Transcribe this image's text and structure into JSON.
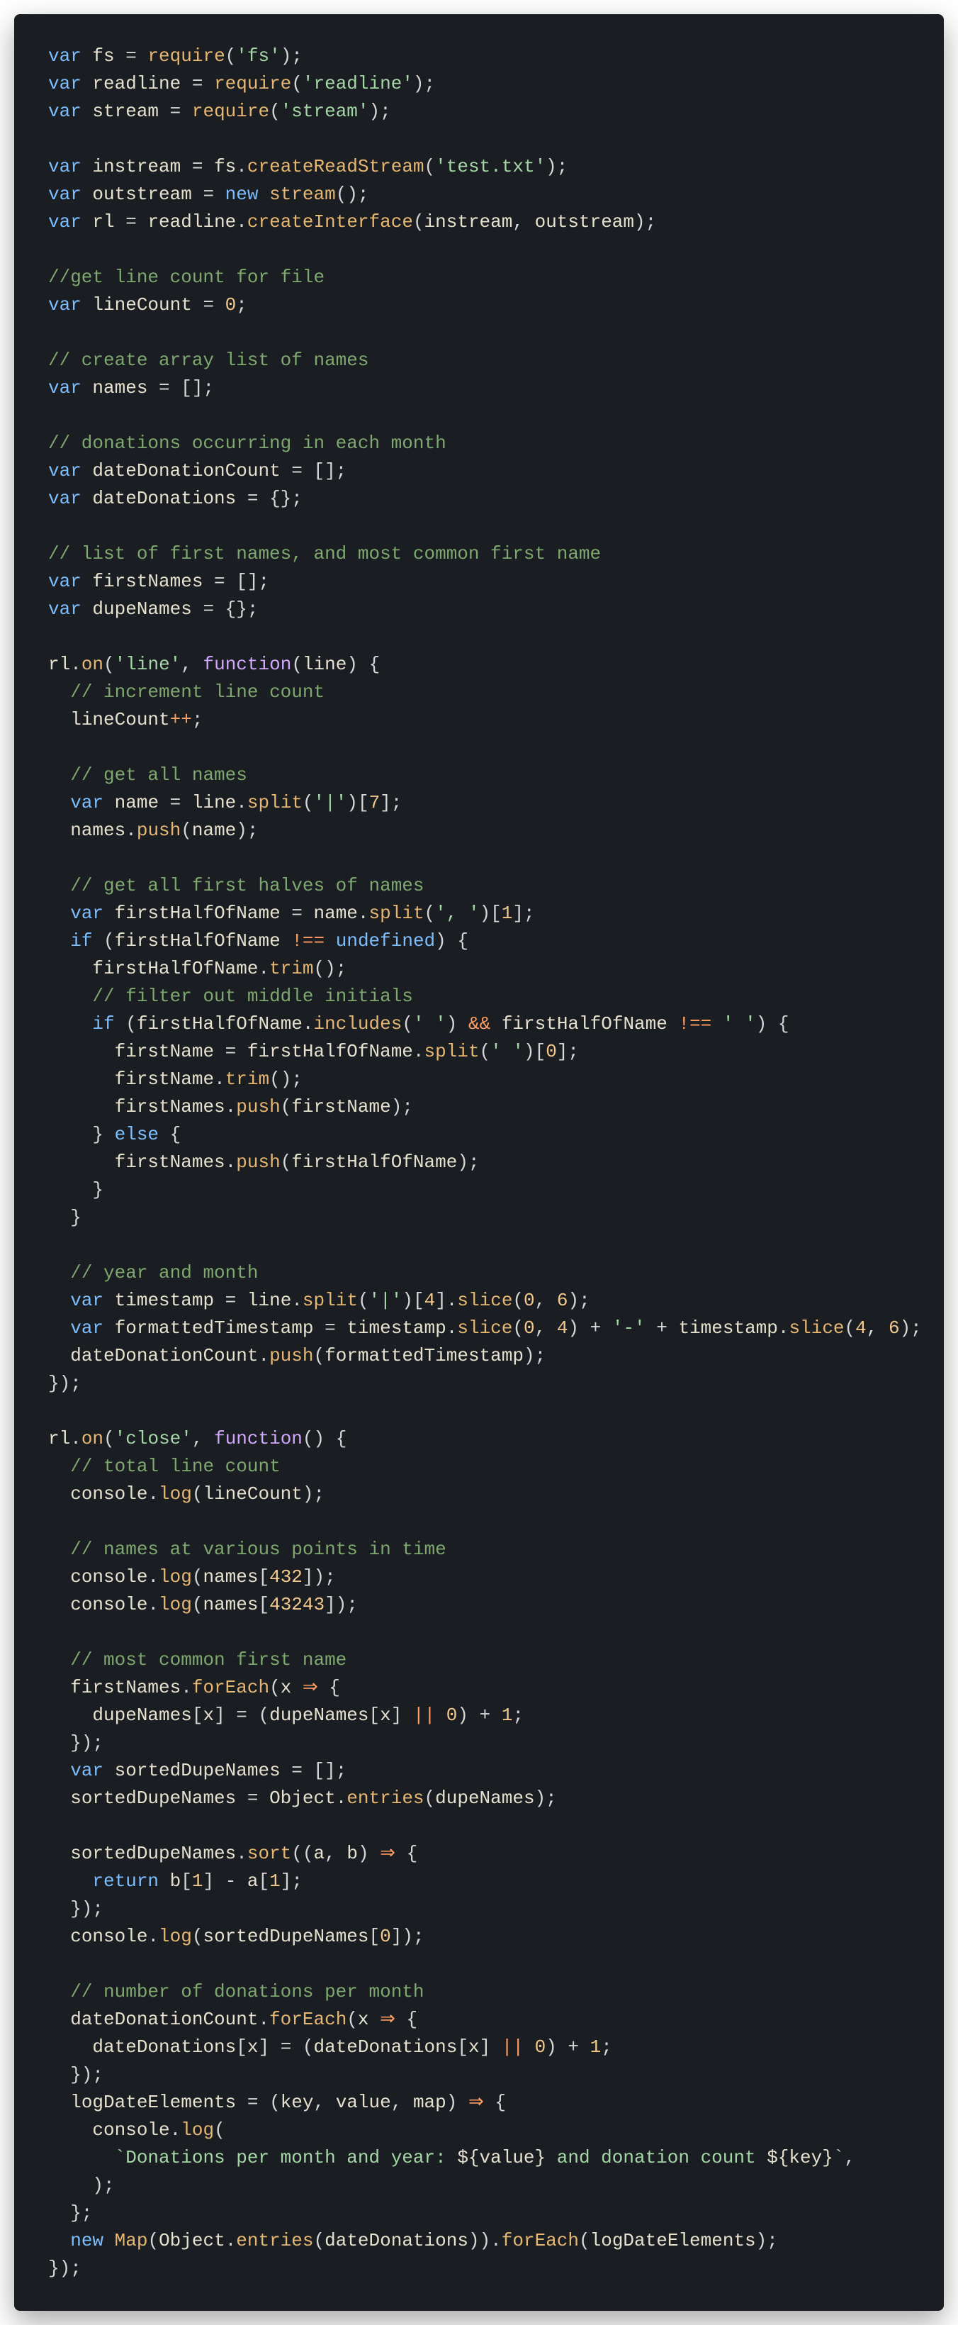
{
  "code": {
    "lines": [
      [
        [
          "kw",
          "var "
        ],
        [
          "id",
          "fs "
        ],
        [
          "",
          "= "
        ],
        [
          "call",
          "require"
        ],
        [
          "",
          "("
        ],
        [
          "str",
          "'fs'"
        ],
        [
          "",
          ");"
        ]
      ],
      [
        [
          "kw",
          "var "
        ],
        [
          "id",
          "readline "
        ],
        [
          "",
          "= "
        ],
        [
          "call",
          "require"
        ],
        [
          "",
          "("
        ],
        [
          "str",
          "'readline'"
        ],
        [
          "",
          ");"
        ]
      ],
      [
        [
          "kw",
          "var "
        ],
        [
          "id",
          "stream "
        ],
        [
          "",
          "= "
        ],
        [
          "call",
          "require"
        ],
        [
          "",
          "("
        ],
        [
          "str",
          "'stream'"
        ],
        [
          "",
          ");"
        ]
      ],
      [
        [
          "",
          ""
        ]
      ],
      [
        [
          "kw",
          "var "
        ],
        [
          "id",
          "instream "
        ],
        [
          "",
          "= fs."
        ],
        [
          "call",
          "createReadStream"
        ],
        [
          "",
          "("
        ],
        [
          "str",
          "'test.txt'"
        ],
        [
          "",
          ");"
        ]
      ],
      [
        [
          "kw",
          "var "
        ],
        [
          "id",
          "outstream "
        ],
        [
          "",
          "= "
        ],
        [
          "kw",
          "new "
        ],
        [
          "call",
          "stream"
        ],
        [
          "",
          "();"
        ]
      ],
      [
        [
          "kw",
          "var "
        ],
        [
          "id",
          "rl "
        ],
        [
          "",
          "= readline."
        ],
        [
          "call",
          "createInterface"
        ],
        [
          "",
          "(instream, outstream);"
        ]
      ],
      [
        [
          "",
          ""
        ]
      ],
      [
        [
          "cmt2",
          "//get line count for file"
        ]
      ],
      [
        [
          "kw",
          "var "
        ],
        [
          "id",
          "lineCount "
        ],
        [
          "",
          "= "
        ],
        [
          "num",
          "0"
        ],
        [
          "",
          ";"
        ]
      ],
      [
        [
          "",
          ""
        ]
      ],
      [
        [
          "cmt2",
          "// create array list of names"
        ]
      ],
      [
        [
          "kw",
          "var "
        ],
        [
          "id",
          "names "
        ],
        [
          "",
          "= [];"
        ]
      ],
      [
        [
          "",
          ""
        ]
      ],
      [
        [
          "cmt2",
          "// donations occurring in each month"
        ]
      ],
      [
        [
          "kw",
          "var "
        ],
        [
          "id",
          "dateDonationCount "
        ],
        [
          "",
          "= [];"
        ]
      ],
      [
        [
          "kw",
          "var "
        ],
        [
          "id",
          "dateDonations "
        ],
        [
          "",
          "= {};"
        ]
      ],
      [
        [
          "",
          ""
        ]
      ],
      [
        [
          "cmt2",
          "// list of first names, and most common first name"
        ]
      ],
      [
        [
          "kw",
          "var "
        ],
        [
          "id",
          "firstNames "
        ],
        [
          "",
          "= [];"
        ]
      ],
      [
        [
          "kw",
          "var "
        ],
        [
          "id",
          "dupeNames "
        ],
        [
          "",
          "= {};"
        ]
      ],
      [
        [
          "",
          ""
        ]
      ],
      [
        [
          "",
          "rl."
        ],
        [
          "call",
          "on"
        ],
        [
          "",
          "("
        ],
        [
          "str",
          "'line'"
        ],
        [
          "",
          ", "
        ],
        [
          "fn",
          "function"
        ],
        [
          "",
          "(line) {"
        ]
      ],
      [
        [
          "",
          "  "
        ],
        [
          "cmt2",
          "// increment line count"
        ]
      ],
      [
        [
          "",
          "  lineCount"
        ],
        [
          "op",
          "++"
        ],
        [
          "",
          ";"
        ]
      ],
      [
        [
          "",
          ""
        ]
      ],
      [
        [
          "",
          "  "
        ],
        [
          "cmt2",
          "// get all names"
        ]
      ],
      [
        [
          "",
          "  "
        ],
        [
          "kw",
          "var "
        ],
        [
          "id",
          "name "
        ],
        [
          "",
          "= line."
        ],
        [
          "call",
          "split"
        ],
        [
          "",
          "("
        ],
        [
          "str",
          "'|'"
        ],
        [
          "",
          ")["
        ],
        [
          "num",
          "7"
        ],
        [
          "",
          "];"
        ]
      ],
      [
        [
          "",
          "  names."
        ],
        [
          "call",
          "push"
        ],
        [
          "",
          "(name);"
        ]
      ],
      [
        [
          "",
          ""
        ]
      ],
      [
        [
          "",
          "  "
        ],
        [
          "cmt2",
          "// get all first halves of names"
        ]
      ],
      [
        [
          "",
          "  "
        ],
        [
          "kw",
          "var "
        ],
        [
          "id",
          "firstHalfOfName "
        ],
        [
          "",
          "= name."
        ],
        [
          "call",
          "split"
        ],
        [
          "",
          "("
        ],
        [
          "str",
          "', '"
        ],
        [
          "",
          ")["
        ],
        [
          "num",
          "1"
        ],
        [
          "",
          "];"
        ]
      ],
      [
        [
          "",
          "  "
        ],
        [
          "kw",
          "if "
        ],
        [
          "",
          "(firstHalfOfName "
        ],
        [
          "op",
          "!=="
        ],
        [
          "",
          ""
        ],
        [
          "",
          "= "
        ],
        [
          "kw",
          "undefined"
        ],
        [
          "",
          ") {"
        ]
      ],
      [
        [
          "",
          "    firstHalfOfName."
        ],
        [
          "call",
          "trim"
        ],
        [
          "",
          "();"
        ]
      ],
      [
        [
          "",
          "    "
        ],
        [
          "cmt2",
          "// filter out middle initials"
        ]
      ],
      [
        [
          "",
          "    "
        ],
        [
          "kw",
          "if "
        ],
        [
          "",
          "(firstHalfOfName."
        ],
        [
          "call",
          "includes"
        ],
        [
          "",
          "("
        ],
        [
          "str",
          "' '"
        ],
        [
          "",
          ") "
        ],
        [
          "op",
          "&&"
        ],
        [
          "",
          ""
        ],
        [
          "",
          ""
        ],
        [
          "",
          ""
        ],
        [
          "",
          ""
        ],
        [
          "",
          ""
        ],
        [
          "",
          ""
        ],
        [
          "",
          ""
        ],
        [
          "",
          ""
        ],
        [
          "",
          ""
        ]
      ],
      [
        [
          "op",
          " "
        ],
        [
          "",
          "firstHalfOfName "
        ],
        [
          "op",
          "!=="
        ],
        [
          "",
          ""
        ],
        [
          "",
          "= "
        ],
        [
          "str",
          "' '"
        ],
        [
          "",
          ") {"
        ]
      ],
      [
        [
          "",
          "      firstName "
        ],
        [
          "",
          "= firstHalfOfName."
        ],
        [
          "call",
          "split"
        ],
        [
          "",
          "("
        ],
        [
          "str",
          "' '"
        ],
        [
          "",
          ")["
        ],
        [
          "num",
          "0"
        ],
        [
          "",
          "];"
        ]
      ],
      [
        [
          "",
          "      firstName."
        ],
        [
          "call",
          "trim"
        ],
        [
          "",
          "();"
        ]
      ],
      [
        [
          "",
          "      firstNames."
        ],
        [
          "call",
          "push"
        ],
        [
          "",
          "(firstName);"
        ]
      ],
      [
        [
          "",
          "    } "
        ],
        [
          "kw",
          "else "
        ],
        [
          "",
          "{"
        ]
      ],
      [
        [
          "",
          "      firstNames."
        ],
        [
          "call",
          "push"
        ],
        [
          "",
          "(firstHalfOfName);"
        ]
      ],
      [
        [
          "",
          "    }"
        ]
      ],
      [
        [
          "",
          "  }"
        ]
      ],
      [
        [
          "",
          ""
        ]
      ],
      [
        [
          "",
          "  "
        ],
        [
          "cmt2",
          "// year and month"
        ]
      ],
      [
        [
          "",
          "  "
        ],
        [
          "kw",
          "var "
        ],
        [
          "id",
          "timestamp "
        ],
        [
          "",
          "= line."
        ],
        [
          "call",
          "split"
        ],
        [
          "",
          "("
        ],
        [
          "str",
          "'|'"
        ],
        [
          "",
          ")["
        ],
        [
          "num",
          "4"
        ],
        [
          "",
          "]."
        ],
        [
          "call",
          "slice"
        ],
        [
          "",
          "("
        ],
        [
          "num",
          "0"
        ],
        [
          "",
          ", "
        ],
        [
          "num",
          "6"
        ],
        [
          "",
          ");"
        ]
      ],
      [
        [
          "",
          "  "
        ],
        [
          "kw",
          "var "
        ],
        [
          "id",
          "formattedTimestamp "
        ],
        [
          "",
          "= timestamp."
        ],
        [
          "call",
          "slice"
        ],
        [
          "",
          "("
        ],
        [
          "num",
          "0"
        ],
        [
          "",
          ", "
        ],
        [
          "num",
          "4"
        ],
        [
          "",
          ") "
        ],
        [
          "op",
          "+ "
        ],
        [
          "str",
          "'-'"
        ],
        [
          "",
          ""
        ],
        [
          "op",
          " + "
        ],
        [
          "",
          "timestamp."
        ],
        [
          "call",
          "slice"
        ],
        [
          "",
          "("
        ],
        [
          "num",
          "4"
        ],
        [
          "",
          ", "
        ],
        [
          "num",
          "6"
        ],
        [
          "",
          ");"
        ]
      ],
      [
        [
          "",
          "  dateDonationCount."
        ],
        [
          "call",
          "push"
        ],
        [
          "",
          "(formattedTimestamp);"
        ]
      ],
      [
        [
          "",
          "});"
        ]
      ],
      [
        [
          "",
          ""
        ]
      ],
      [
        [
          "",
          "rl."
        ],
        [
          "call",
          "on"
        ],
        [
          "",
          "("
        ],
        [
          "str",
          "'close'"
        ],
        [
          "",
          ", "
        ],
        [
          "fn",
          "function"
        ],
        [
          "",
          "() {"
        ]
      ],
      [
        [
          "",
          "  "
        ],
        [
          "cmt2",
          "// total line count"
        ]
      ],
      [
        [
          "",
          "  console."
        ],
        [
          "call",
          "log"
        ],
        [
          "",
          "(lineCount);"
        ]
      ],
      [
        [
          "",
          ""
        ]
      ],
      [
        [
          "",
          "  "
        ],
        [
          "cmt2",
          "// names at various points in time"
        ]
      ],
      [
        [
          "",
          "  console."
        ],
        [
          "call",
          "log"
        ],
        [
          "",
          "(names["
        ],
        [
          "num",
          "432"
        ],
        [
          "",
          "]);"
        ]
      ],
      [
        [
          "",
          "  console."
        ],
        [
          "call",
          "log"
        ],
        [
          "",
          "(names["
        ],
        [
          "num",
          "43243"
        ],
        [
          "",
          "]);"
        ]
      ],
      [
        [
          "",
          ""
        ]
      ],
      [
        [
          "",
          "  "
        ],
        [
          "cmt2",
          "// most common first name"
        ]
      ],
      [
        [
          "",
          "  firstNames."
        ],
        [
          "call",
          "forEach"
        ],
        [
          "",
          "(x "
        ],
        [
          "op",
          "⇒"
        ],
        [
          "",
          ""
        ],
        [
          "",
          ""
        ],
        [
          "",
          ""
        ],
        [
          "",
          ""
        ],
        [
          "",
          ""
        ],
        [
          "",
          ""
        ]
      ],
      [
        [
          "",
          ""
        ],
        [
          "",
          ""
        ],
        [
          "",
          ""
        ],
        [
          "",
          ""
        ],
        [
          "",
          ""
        ],
        [
          "",
          ""
        ],
        [
          "",
          ""
        ],
        [
          "",
          ""
        ]
      ],
      [
        [
          "",
          ""
        ]
      ]
    ]
  },
  "raw": "var fs = require('fs');\nvar readline = require('readline');\nvar stream = require('stream');\n\nvar instream = fs.createReadStream('test.txt');\nvar outstream = new stream();\nvar rl = readline.createInterface(instream, outstream);\n\n//get line count for file\nvar lineCount = 0;\n\n// create array list of names\nvar names = [];\n\n// donations occurring in each month\nvar dateDonationCount = [];\nvar dateDonations = {};\n\n// list of first names, and most common first name\nvar firstNames = [];\nvar dupeNames = {};\n\nrl.on('line', function(line) {\n  // increment line count\n  lineCount++;\n\n  // get all names\n  var name = line.split('|')[7];\n  names.push(name);\n\n  // get all first halves of names\n  var firstHalfOfName = name.split(', ')[1];\n  if (firstHalfOfName !== undefined) {\n    firstHalfOfName.trim();\n    // filter out middle initials\n    if (firstHalfOfName.includes(' ') && firstHalfOfName !== ' ') {\n      firstName = firstHalfOfName.split(' ')[0];\n      firstName.trim();\n      firstNames.push(firstName);\n    } else {\n      firstNames.push(firstHalfOfName);\n    }\n  }\n\n  // year and month\n  var timestamp = line.split('|')[4].slice(0, 6);\n  var formattedTimestamp = timestamp.slice(0, 4) + '-' + timestamp.slice(4, 6);\n  dateDonationCount.push(formattedTimestamp);\n});\n\nrl.on('close', function() {\n  // total line count\n  console.log(lineCount);\n\n  // names at various points in time\n  console.log(names[432]);\n  console.log(names[43243]);\n\n  // most common first name\n  firstNames.forEach(x => {\n    dupeNames[x] = (dupeNames[x] || 0) + 1;\n  });\n  var sortedDupeNames = [];\n  sortedDupeNames = Object.entries(dupeNames);\n\n  sortedDupeNames.sort((a, b) => {\n    return b[1] - a[1];\n  });\n  console.log(sortedDupeNames[0]);\n\n  // number of donations per month\n  dateDonationCount.forEach(x => {\n    dateDonations[x] = (dateDonations[x] || 0) + 1;\n  });\n  logDateElements = (key, value, map) => {\n    console.log(\n      `Donations per month and year: ${value} and donation count ${key}`,\n    );\n  };\n  new Map(Object.entries(dateDonations)).forEach(logDateElements);\n});"
}
